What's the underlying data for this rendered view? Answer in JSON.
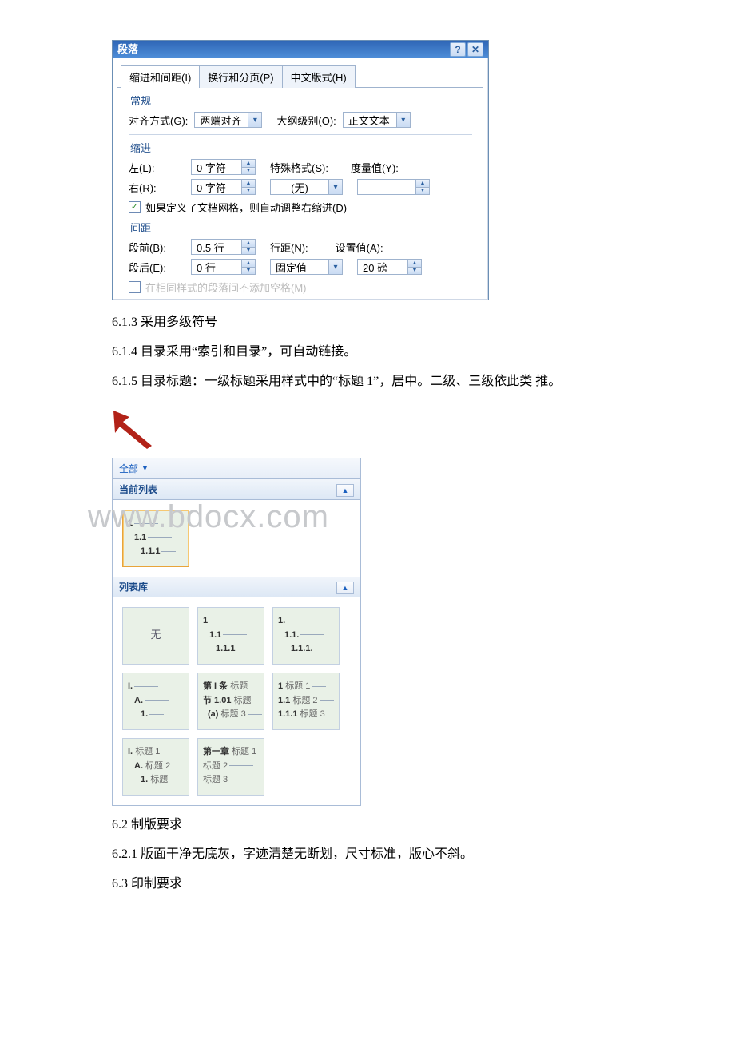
{
  "dialog": {
    "title": "段落",
    "tabs": {
      "indent": "缩进和间距(I)",
      "page": "换行和分页(P)",
      "cjk": "中文版式(H)"
    },
    "general_label": "常规",
    "align_label": "对齐方式(G):",
    "align_value": "两端对齐",
    "outline_label": "大纲级别(O):",
    "outline_value": "正文文本",
    "indent_label": "缩进",
    "left_label": "左(L):",
    "left_value": "0 字符",
    "right_label": "右(R):",
    "right_value": "0 字符",
    "special_label": "特殊格式(S):",
    "special_value": "(无)",
    "measure_label": "度量值(Y):",
    "measure_value": "",
    "auto_indent": "如果定义了文档网格，则自动调整右缩进(D)",
    "spacing_label": "间距",
    "before_label": "段前(B):",
    "before_value": "0.5 行",
    "after_label": "段后(E):",
    "after_value": "0 行",
    "linesp_label": "行距(N):",
    "linesp_value": "固定值",
    "setval_label": "设置值(A):",
    "setval_value": "20 磅",
    "nospace_label": "在相同样式的段落间不添加空格(M)"
  },
  "text": {
    "l1": "6.1.3  采用多级符号",
    "l2": "6.1.4  目录采用“索引和目录”，可自动链接。",
    "l3": "6.1.5  目录标题：一级标题采用样式中的“标题 1”，居中。二级、三级依此类 推。",
    "l4": "6.2  制版要求",
    "l5": "6.2.1  版面干净无底灰，字迹清楚无断划，尺寸标准，版心不斜。",
    "l6": "6.3  印制要求"
  },
  "panel": {
    "all": "全部",
    "current": "当前列表",
    "library": "列表库",
    "none": "无",
    "cur1": "1",
    "cur2": "1.1",
    "cur3": "1.1.1",
    "t2a": "1",
    "t2b": "1.1",
    "t2c": "1.1.1",
    "t3a": "1.",
    "t3b": "1.1.",
    "t3c": "1.1.1.",
    "t4a": "I.",
    "t4b": "A.",
    "t4c": "1.",
    "t5a": "第 I 条",
    "t5a2": "标题",
    "t5b": "节 1.01",
    "t5b2": "标题",
    "t5c": "(a)",
    "t5c2": "标题 3",
    "t6a": "1",
    "t6a2": "标题 1",
    "t6b": "1.1",
    "t6b2": "标题 2",
    "t6c": "1.1.1",
    "t6c2": "标题 3",
    "t7a": "I.",
    "t7a2": "标题 1",
    "t7b": "A.",
    "t7b2": "标题 2",
    "t7c": "1.",
    "t7c2": "标题",
    "t8a": "第一章",
    "t8a2": "标题 1",
    "t8b": "标题 2",
    "t8c": "标题 3"
  },
  "watermark": "www.bdocx.com"
}
